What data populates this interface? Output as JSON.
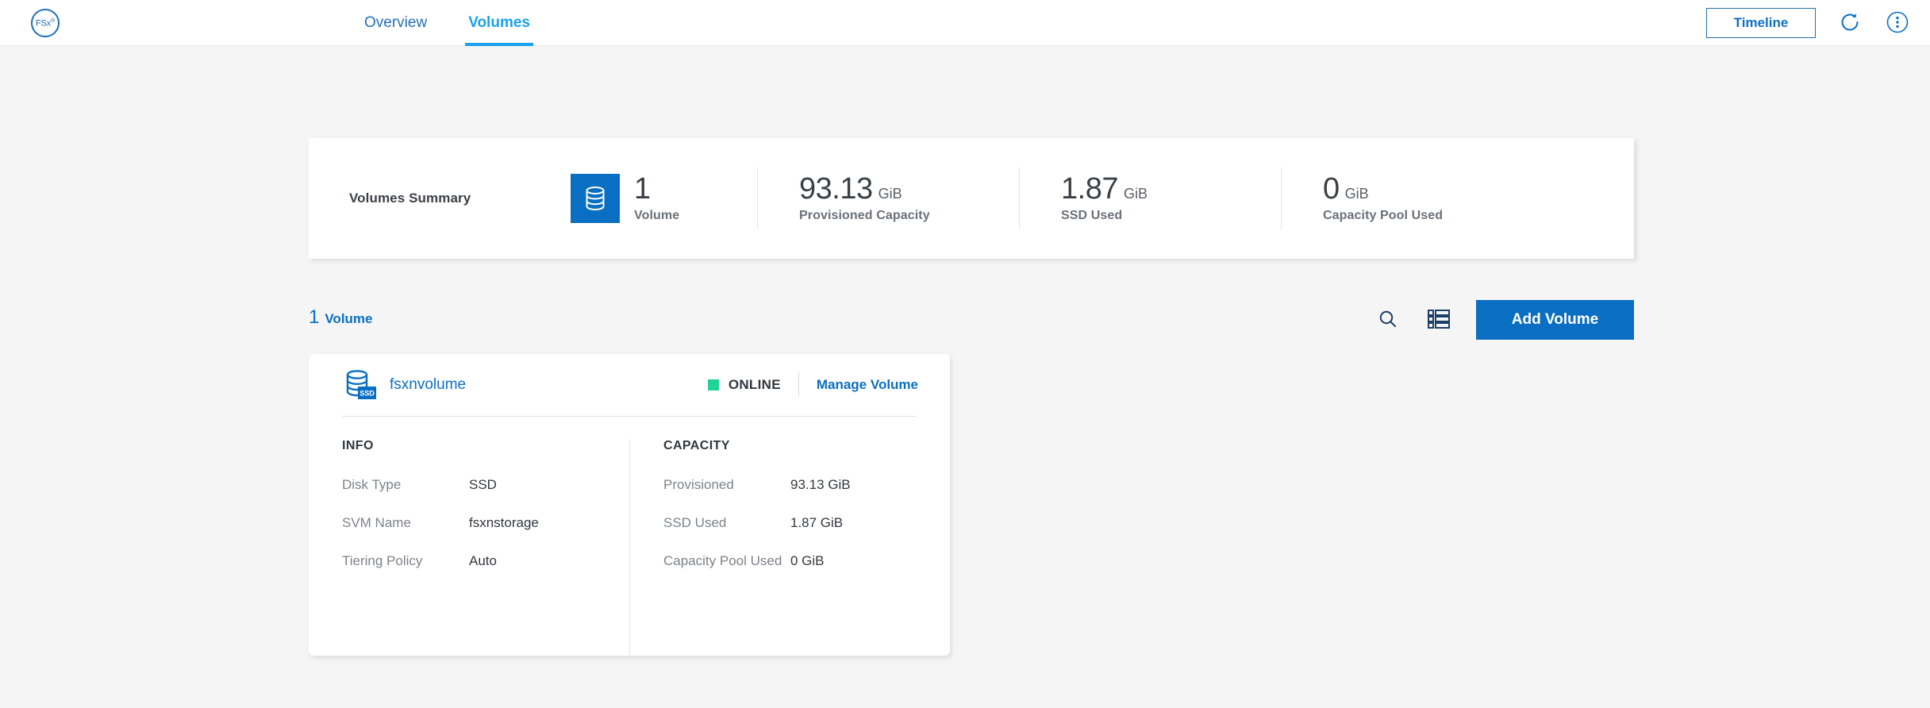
{
  "brand": {
    "logo_text": "FSx",
    "logo_sup": "®"
  },
  "header": {
    "tabs": [
      {
        "label": "Overview",
        "active": false
      },
      {
        "label": "Volumes",
        "active": true
      }
    ],
    "timeline_label": "Timeline",
    "refresh_icon": "refresh-icon",
    "more_icon": "more-vertical-icon"
  },
  "summary": {
    "title": "Volumes Summary",
    "metrics": [
      {
        "value": "1",
        "unit": "",
        "label": "Volume",
        "icon": "volume-database-icon"
      },
      {
        "value": "93.13",
        "unit": "GiB",
        "label": "Provisioned Capacity"
      },
      {
        "value": "1.87",
        "unit": "GiB",
        "label": "SSD Used"
      },
      {
        "value": "0",
        "unit": "GiB",
        "label": "Capacity Pool Used"
      }
    ]
  },
  "toolbar": {
    "count_number": "1",
    "count_word": "Volume",
    "search_icon": "search-icon",
    "list_view_icon": "list-view-icon",
    "add_volume_label": "Add Volume"
  },
  "volume_card": {
    "name": "fsxnvolume",
    "icon": "volume-ssd-database-icon",
    "status": "ONLINE",
    "status_color": "#1fd494",
    "manage_label": "Manage Volume",
    "info": {
      "title": "INFO",
      "rows": [
        {
          "key": "Disk Type",
          "value": "SSD"
        },
        {
          "key": "SVM Name",
          "value": "fsxnstorage"
        },
        {
          "key": "Tiering Policy",
          "value": "Auto"
        }
      ]
    },
    "capacity": {
      "title": "CAPACITY",
      "rows": [
        {
          "key": "Provisioned",
          "value": "93.13 GiB"
        },
        {
          "key": "SSD Used",
          "value": "1.87 GiB"
        },
        {
          "key": "Capacity Pool Used",
          "value": "0 GiB"
        }
      ]
    }
  },
  "colors": {
    "primary_blue": "#0a6fc2",
    "active_tab_blue": "#1ba2f0",
    "nav_blue": "#2470b3",
    "status_green": "#1fd494",
    "page_bg": "#f5f5f5"
  }
}
